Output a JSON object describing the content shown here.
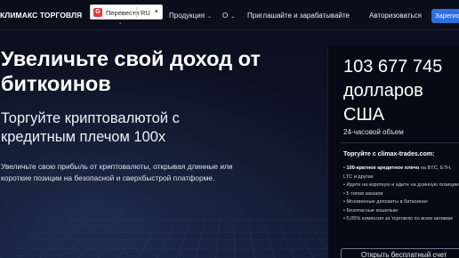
{
  "header": {
    "brand": "КЛИМАКС ТОРГОВЛЯ",
    "translate": {
      "icon_letter": "G",
      "label": "Перевести",
      "language": "RU"
    },
    "nav": [
      {
        "label": "Продукция"
      },
      {
        "label": "О"
      },
      {
        "label": "Приглашайте и зарабатывайте"
      }
    ],
    "login": "Авторизоваться",
    "register": "Зарегистрироваться"
  },
  "hero": {
    "title": "Увеличьте свой доход от биткоинов",
    "subtitle": "Торгуйте криптовалютой с кредитным плечом 100х",
    "description": "Увеличьте свою прибыль от криптовалюты, открывая длинные или короткие позиции на безопасной и сверхбыстрой платформе."
  },
  "stats": {
    "value": "103 677 745 долларов США",
    "caption": "24-часовой объем",
    "site_line": "Торгуйте с climax-trades.com:",
    "features": [
      {
        "bold": "100-кратное кредитное плечо",
        "rest": " на BTC, ETH, LTC и другие"
      },
      {
        "bold": "",
        "rest": "Идите на короткую и идите на длинную позицию"
      },
      {
        "bold": "",
        "rest": "5 типов заказов"
      },
      {
        "bold": "",
        "rest": "Мгновенные депозиты в биткоинах"
      },
      {
        "bold": "",
        "rest": "Безопасные кошельки"
      },
      {
        "bold": "",
        "rest": "0,05% комиссия за торговлю по всем активам"
      }
    ],
    "cta": "Открыть бесплатный счет"
  },
  "colors": {
    "accent": "#2f6fe0",
    "background": "#0b1020",
    "panel": "#070a14"
  },
  "icons": {
    "translate": "google-translate-icon",
    "chevron": "chevron-down-icon"
  }
}
